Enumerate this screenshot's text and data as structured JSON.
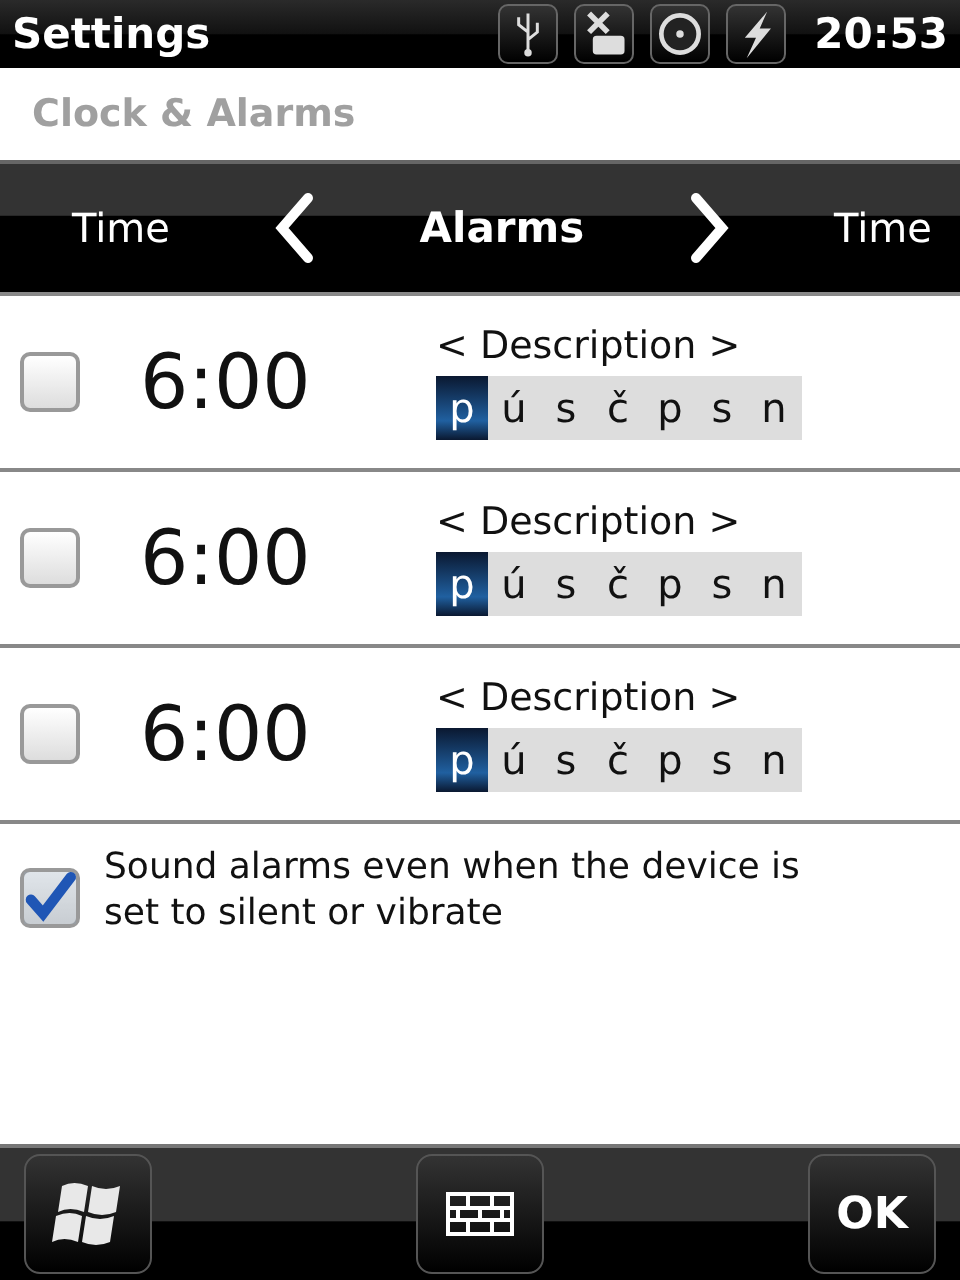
{
  "status_bar": {
    "title": "Settings",
    "time": "20:53"
  },
  "subtitle": "Clock & Alarms",
  "tabs": [
    {
      "label": "Time",
      "selected": false
    },
    {
      "label": "Alarms",
      "selected": true
    },
    {
      "label": "Time",
      "selected": false
    }
  ],
  "alarms": [
    {
      "checked": false,
      "time": "6:00",
      "description": "< Description >",
      "days": [
        {
          "label": "p",
          "on": true
        },
        {
          "label": "ú",
          "on": false
        },
        {
          "label": "s",
          "on": false
        },
        {
          "label": "č",
          "on": false
        },
        {
          "label": "p",
          "on": false
        },
        {
          "label": "s",
          "on": false
        },
        {
          "label": "n",
          "on": false
        }
      ]
    },
    {
      "checked": false,
      "time": "6:00",
      "description": "< Description >",
      "days": [
        {
          "label": "p",
          "on": true
        },
        {
          "label": "ú",
          "on": false
        },
        {
          "label": "s",
          "on": false
        },
        {
          "label": "č",
          "on": false
        },
        {
          "label": "p",
          "on": false
        },
        {
          "label": "s",
          "on": false
        },
        {
          "label": "n",
          "on": false
        }
      ]
    },
    {
      "checked": false,
      "time": "6:00",
      "description": "< Description >",
      "days": [
        {
          "label": "p",
          "on": true
        },
        {
          "label": "ú",
          "on": false
        },
        {
          "label": "s",
          "on": false
        },
        {
          "label": "č",
          "on": false
        },
        {
          "label": "p",
          "on": false
        },
        {
          "label": "s",
          "on": false
        },
        {
          "label": "n",
          "on": false
        }
      ]
    }
  ],
  "sound_option": {
    "checked": true,
    "label": "Sound alarms even when the device is set to silent or vibrate"
  },
  "softkeys": {
    "right": "OK"
  }
}
